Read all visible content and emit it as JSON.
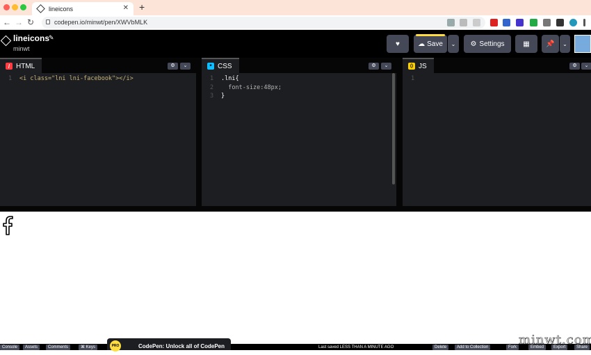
{
  "browser": {
    "tab_title": "lineicons",
    "tab_close": "✕",
    "new_tab": "+",
    "url": "codepen.io/minwt/pen/XWVbMLK",
    "back": "←",
    "forward": "→",
    "reload": "↻"
  },
  "header": {
    "pen_title": "lineicons",
    "pen_user": "minwt",
    "edit_icon": "pencil-icon",
    "save_label": "Save",
    "settings_label": "Settings"
  },
  "editors": [
    {
      "name": "HTML",
      "icon_char": "/",
      "icon_color": "#ff3c41",
      "lines": [
        {
          "n": "1",
          "code": "<i class=\"lni lni-facebook\"></i>"
        }
      ]
    },
    {
      "name": "CSS",
      "icon_char": "*",
      "icon_color": "#0ebeff",
      "lines": [
        {
          "n": "1",
          "code": ".lni{"
        },
        {
          "n": "2",
          "code": "  font-size:48px;"
        },
        {
          "n": "3",
          "code": "}"
        }
      ]
    },
    {
      "name": "JS",
      "icon_char": "()",
      "icon_color": "#fcd000",
      "lines": [
        {
          "n": "1",
          "code": ""
        }
      ]
    }
  ],
  "bottom_bar": {
    "buttons": [
      "Console",
      "Assets",
      "Comments",
      "⌘ Keys"
    ],
    "promo": "CodePen: Unlock all of CodePen",
    "pro_badge": "PRO",
    "last_saved": "Last saved LESS THAN A MINUTE AGO",
    "right_buttons": [
      "Delete",
      "Add to Collection",
      "Fork",
      "Embed",
      "Export",
      "Share"
    ]
  },
  "watermark": "minwt.com",
  "colors": {
    "save_accent": "#ffdd40",
    "editor_bg": "#1d1e22",
    "button_bg": "#444857"
  }
}
